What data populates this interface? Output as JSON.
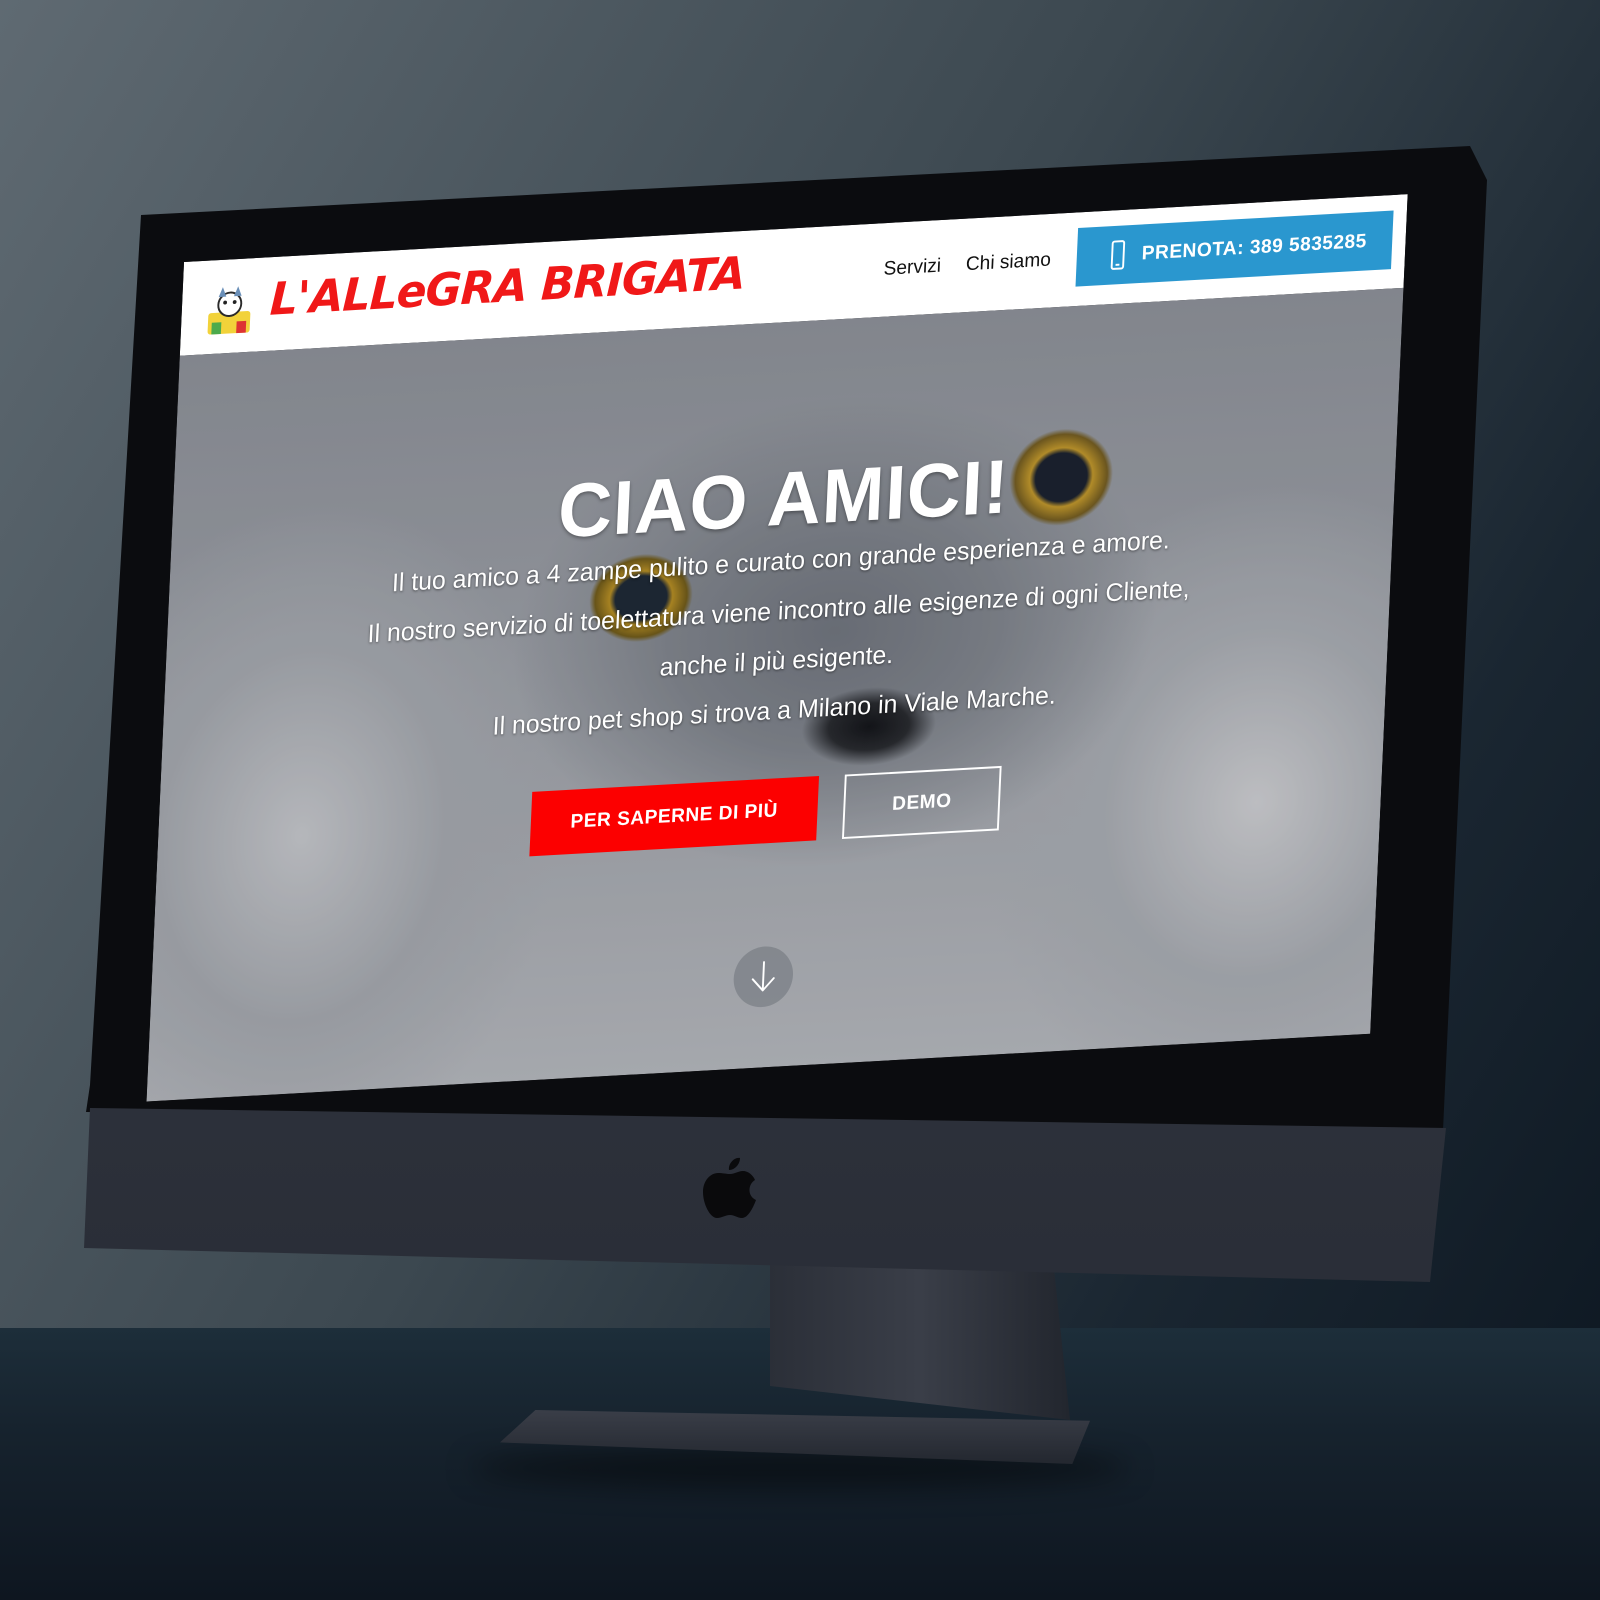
{
  "site": {
    "brand_name": "L'ALLeGRA BRIGATA",
    "nav": {
      "items": [
        {
          "label": "Servizi"
        },
        {
          "label": "Chi siamo"
        }
      ],
      "cta_label": "PRENOTA: 389 5835285"
    },
    "hero": {
      "title": "CIAO AMICI!",
      "lines": [
        "Il tuo amico a 4 zampe pulito e curato con grande esperienza e amore.",
        "Il nostro servizio di toelettatura viene incontro alle esigenze di ogni Cliente,",
        "anche il più esigente.",
        "Il nostro pet shop si trova a Milano in Viale Marche."
      ],
      "primary_button": "PER SAPERNE DI PIÙ",
      "secondary_button": "DEMO"
    }
  },
  "colors": {
    "brand_red": "#f01818",
    "cta_blue": "#2a97cf",
    "button_red": "#fc0000"
  },
  "icons": {
    "phone": "smartphone-icon",
    "scroll": "arrow-down-icon",
    "hardware_logo": "apple-icon",
    "mascot": "mascot-logo-icon"
  }
}
